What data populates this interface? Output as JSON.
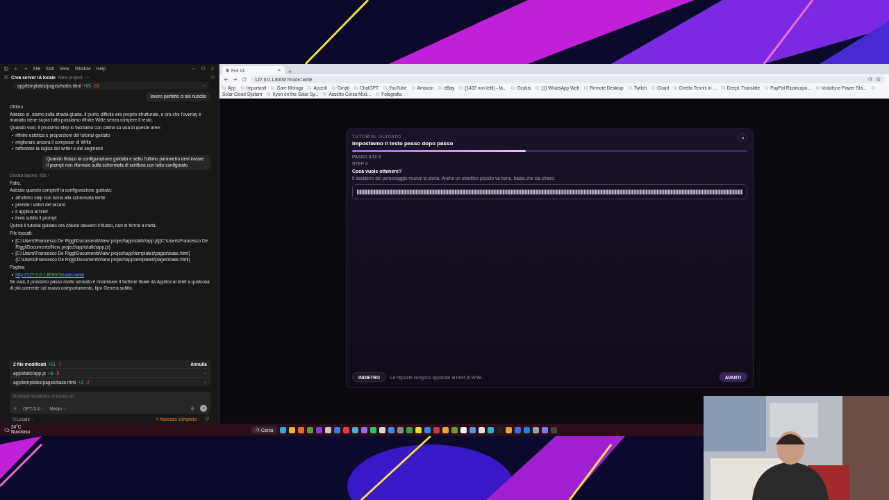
{
  "chat_app": {
    "menu": [
      "File",
      "Edit",
      "View",
      "Window",
      "Help"
    ],
    "title": "Crea server IA locale",
    "project": "New project",
    "more": "···",
    "diff_file": {
      "path": "app/templates/pages/index.html",
      "added": "+65",
      "removed": "-91"
    },
    "messages": [
      {
        "kind": "user",
        "text": "lavoro perfetto ci sei riuscito"
      },
      {
        "kind": "assistant",
        "blocks": [
          {
            "kind": "text",
            "text": "Ottimo."
          },
          {
            "kind": "text",
            "text": "Adesso sì, siamo sulla strada giusta. Il punto difficile era proprio strutturale, e ora che l'overlay è montato bene sopra tutto possiamo rifinire Write senza rompere il resto."
          },
          {
            "kind": "text",
            "text": "Quando vuoi, il prossimo step lo facciamo con calma su una di queste aree:"
          },
          {
            "kind": "list",
            "bullet": "•",
            "items": [
              "rifinire estetica e proporzioni del tutorial guidato",
              "migliorare ancora il composer di Write",
              "rafforzare la logica dei writer e dei segmenti"
            ]
          }
        ]
      },
      {
        "kind": "user",
        "text": "Quando finisco la configurazione guidata e setto l'ultimo parametro devi inviare il prompt non ritornare sulla schermata di scrittura con tutto configurato"
      },
      {
        "kind": "meta",
        "text": "Durata lavoro: 41s ›"
      },
      {
        "kind": "assistant",
        "blocks": [
          {
            "kind": "text",
            "text": "Fatto."
          },
          {
            "kind": "text",
            "text": "Adesso quando completi la configurazione guidata:"
          },
          {
            "kind": "list",
            "bullet": "•",
            "items": [
              "all'ultimo step non torna alla schermata Write",
              "prende i valori del wizard",
              "li applica al brief",
              "invia subito il prompt"
            ]
          },
          {
            "kind": "text",
            "text": "Quindi il tutorial guidato ora chiude davvero il flusso, non si ferma a metà."
          },
          {
            "kind": "text",
            "text": "File toccati:"
          },
          {
            "kind": "list",
            "bullet": "•",
            "items": [
              "[C:\\Users\\Francesco De Riggi\\Documents\\New project\\app\\static\\app.js](C:\\Users\\Francesco De Riggi\\Documents\\New project\\app\\static\\app.js)",
              "[C:\\Users\\Francesco De Riggi\\Documents\\New project\\app\\templates\\pages\\base.html](C:\\Users\\Francesco De Riggi\\Documents\\New project\\app\\templates\\pages\\base.html)"
            ]
          },
          {
            "kind": "text",
            "text": "Pagina:"
          },
          {
            "kind": "links",
            "bullet": "•",
            "items": [
              "http://127.0.0.1:8000/?mode=write"
            ]
          },
          {
            "kind": "text",
            "text": "Se vuoi, il prossimo passo molto sensato è rinominare il bottone finale da Applica al brief a qualcosa di più coerente col nuovo comportamento, tipo Genera subito."
          }
        ]
      }
    ],
    "changes": {
      "summary": "2 file modificati",
      "added": "+11",
      "removed": "-7",
      "undo": "Annulla",
      "files": [
        {
          "path": "app/static/app.js",
          "added": "+8",
          "removed": "-5"
        },
        {
          "path": "app/templates/pages/base.html",
          "added": "+3",
          "removed": "-2"
        }
      ]
    },
    "composer": {
      "placeholder": "Richiedi modifiche di follow-up",
      "model": "GPT-5.4",
      "effort": "Medio"
    },
    "footer": {
      "env": "Locale",
      "access": "Accesso completo"
    }
  },
  "browser": {
    "tab": {
      "title": "Fox v1"
    },
    "url": "127.0.0.1:8000/?mode=write",
    "bookmarks": [
      "App",
      "Importanti",
      "Gare Motogp",
      "Accedi",
      "Gmail",
      "ChatGPT",
      "YouTube",
      "Amazon",
      "eBay",
      "(1422 non letti) - fa...",
      "Oculus",
      "(1) WhatsApp Web",
      "Remote Desktop",
      "Twitch",
      "Cloud",
      "Diretta Tennis in ...",
      "DeepL Translate",
      "PayPal Ricaricapo...",
      "Vodafone Power Sta...",
      "Solar Cloud System",
      "Kyon on the Solar Sy...",
      "Assetto Corsa Mod...",
      "Fotografia"
    ],
    "modal": {
      "eyebrow": "TUTORIAL GUIDATO",
      "title": "Impostiamo il testo passo dopo passo",
      "close": "×",
      "level": 0.44,
      "progress_label": "PASSO 4 DI 9",
      "step": "STEP 4",
      "question": "Cosa vuole ottenere?",
      "hint": "Il desiderio del personaggio muove la storia. Anche un obiettivo piccolo va bene, basta che sia chiaro.",
      "back": "INDIETRO",
      "note": "Le risposte vengono applicate al brief di Write.",
      "next": "AVANTI"
    }
  },
  "taskbar": {
    "weather": {
      "temp": "24°C",
      "condition": "Nuvoloso"
    },
    "search": "Cerca",
    "apps": [
      {
        "color": "#3aa0e8"
      },
      {
        "color": "#e8b23a"
      },
      {
        "color": "#e86a2a"
      },
      {
        "color": "#5a9a3a"
      },
      {
        "color": "#8a3ad8"
      },
      {
        "color": "#c8c8c8"
      },
      {
        "color": "#3a7ae8"
      },
      {
        "color": "#e83a3a"
      },
      {
        "color": "#4ab0c8"
      },
      {
        "color": "#9a6ae8"
      },
      {
        "color": "#2ac85a"
      },
      {
        "color": "#d8d8d8"
      },
      {
        "color": "#3a8ae8"
      },
      {
        "color": "#8a8a8a"
      },
      {
        "color": "#2aa83a"
      },
      {
        "color": "#e8d83a"
      },
      {
        "color": "#2a8ae8"
      },
      {
        "color": "#c83a3a"
      },
      {
        "color": "#e8a83a"
      },
      {
        "color": "#6a9a3a"
      },
      {
        "color": "#f0f0f0"
      },
      {
        "color": "#6a8ae8"
      },
      {
        "color": "#e0e0e0"
      },
      {
        "color": "#3aa8c8"
      },
      {
        "color": "#222222"
      },
      {
        "color": "#e8a03a"
      },
      {
        "color": "#3a6ae8"
      },
      {
        "color": "#2a7ad8"
      },
      {
        "color": "#9aa0a8"
      },
      {
        "color": "#7a7ae8"
      },
      {
        "color": "#444444"
      }
    ]
  }
}
